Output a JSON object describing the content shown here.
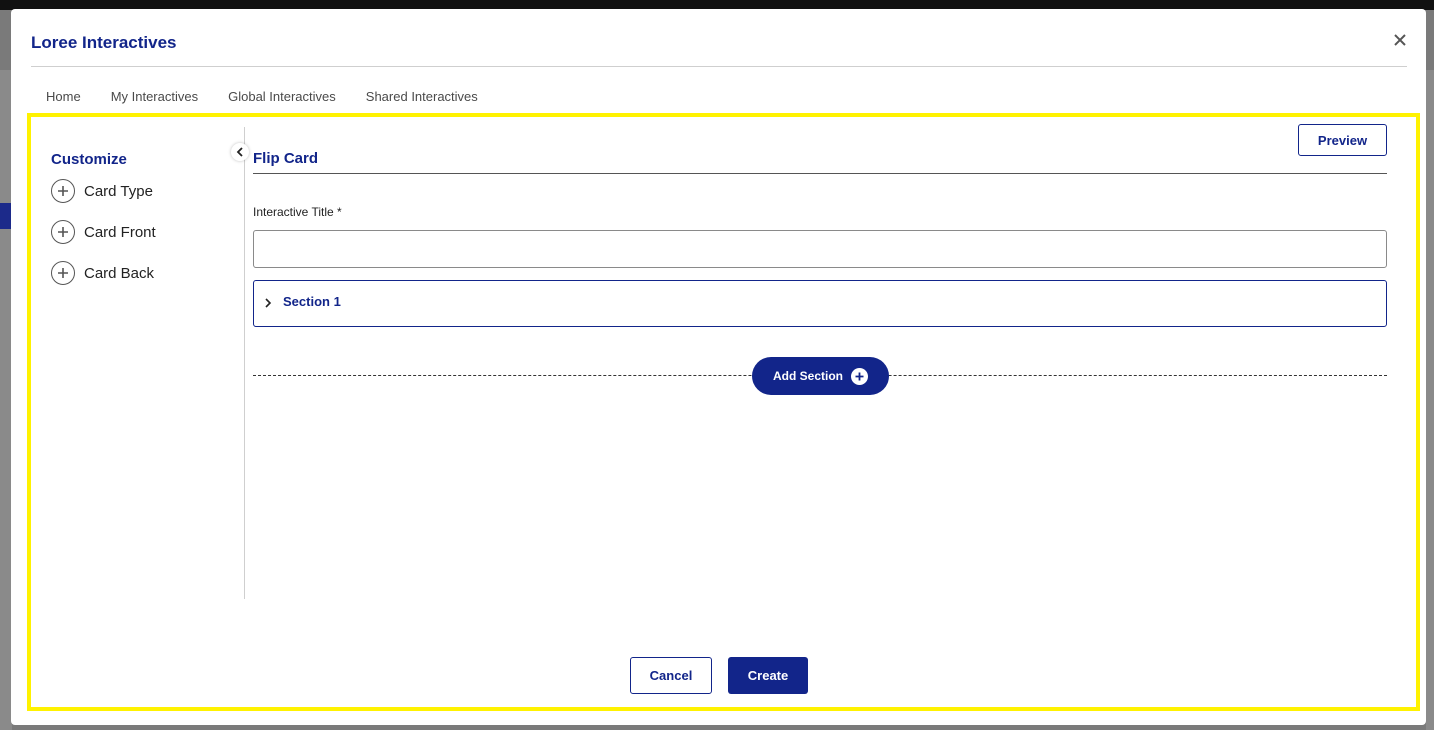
{
  "modal": {
    "title": "Loree Interactives"
  },
  "tabs": [
    {
      "label": "Home"
    },
    {
      "label": "My Interactives"
    },
    {
      "label": "Global Interactives"
    },
    {
      "label": "Shared Interactives"
    }
  ],
  "sidebar": {
    "title": "Customize",
    "items": [
      {
        "label": "Card Type",
        "icon": "plus-circle-icon"
      },
      {
        "label": "Card Front",
        "icon": "plus-circle-icon"
      },
      {
        "label": "Card Back",
        "icon": "plus-circle-icon"
      }
    ]
  },
  "main": {
    "title": "Flip Card",
    "preview_label": "Preview",
    "field_label": "Interactive Title *",
    "title_value": "",
    "section_label": "Section 1",
    "add_section_label": "Add Section"
  },
  "footer": {
    "cancel_label": "Cancel",
    "create_label": "Create"
  },
  "colors": {
    "accent": "#12258a",
    "highlight": "#fff200"
  }
}
